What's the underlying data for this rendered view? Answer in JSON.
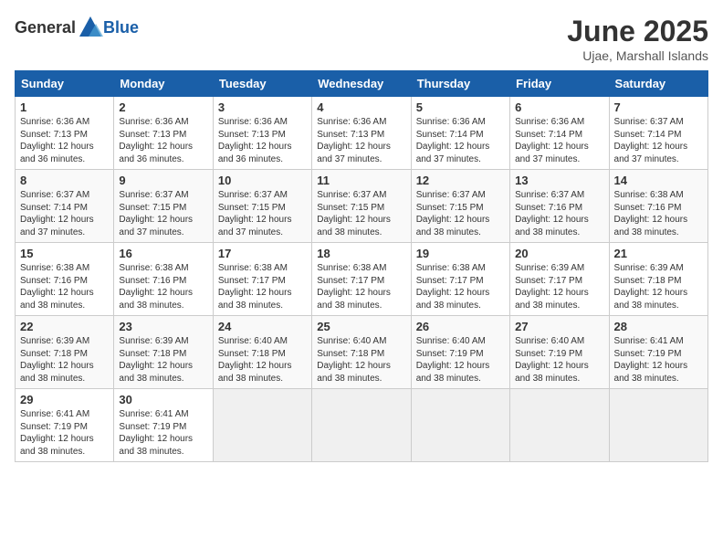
{
  "logo": {
    "general": "General",
    "blue": "Blue"
  },
  "title": "June 2025",
  "subtitle": "Ujae, Marshall Islands",
  "headers": [
    "Sunday",
    "Monday",
    "Tuesday",
    "Wednesday",
    "Thursday",
    "Friday",
    "Saturday"
  ],
  "weeks": [
    [
      {
        "day": "1",
        "sunrise": "6:36 AM",
        "sunset": "7:13 PM",
        "daylight": "12 hours and 36 minutes."
      },
      {
        "day": "2",
        "sunrise": "6:36 AM",
        "sunset": "7:13 PM",
        "daylight": "12 hours and 36 minutes."
      },
      {
        "day": "3",
        "sunrise": "6:36 AM",
        "sunset": "7:13 PM",
        "daylight": "12 hours and 36 minutes."
      },
      {
        "day": "4",
        "sunrise": "6:36 AM",
        "sunset": "7:13 PM",
        "daylight": "12 hours and 37 minutes."
      },
      {
        "day": "5",
        "sunrise": "6:36 AM",
        "sunset": "7:14 PM",
        "daylight": "12 hours and 37 minutes."
      },
      {
        "day": "6",
        "sunrise": "6:36 AM",
        "sunset": "7:14 PM",
        "daylight": "12 hours and 37 minutes."
      },
      {
        "day": "7",
        "sunrise": "6:37 AM",
        "sunset": "7:14 PM",
        "daylight": "12 hours and 37 minutes."
      }
    ],
    [
      {
        "day": "8",
        "sunrise": "6:37 AM",
        "sunset": "7:14 PM",
        "daylight": "12 hours and 37 minutes."
      },
      {
        "day": "9",
        "sunrise": "6:37 AM",
        "sunset": "7:15 PM",
        "daylight": "12 hours and 37 minutes."
      },
      {
        "day": "10",
        "sunrise": "6:37 AM",
        "sunset": "7:15 PM",
        "daylight": "12 hours and 37 minutes."
      },
      {
        "day": "11",
        "sunrise": "6:37 AM",
        "sunset": "7:15 PM",
        "daylight": "12 hours and 38 minutes."
      },
      {
        "day": "12",
        "sunrise": "6:37 AM",
        "sunset": "7:15 PM",
        "daylight": "12 hours and 38 minutes."
      },
      {
        "day": "13",
        "sunrise": "6:37 AM",
        "sunset": "7:16 PM",
        "daylight": "12 hours and 38 minutes."
      },
      {
        "day": "14",
        "sunrise": "6:38 AM",
        "sunset": "7:16 PM",
        "daylight": "12 hours and 38 minutes."
      }
    ],
    [
      {
        "day": "15",
        "sunrise": "6:38 AM",
        "sunset": "7:16 PM",
        "daylight": "12 hours and 38 minutes."
      },
      {
        "day": "16",
        "sunrise": "6:38 AM",
        "sunset": "7:16 PM",
        "daylight": "12 hours and 38 minutes."
      },
      {
        "day": "17",
        "sunrise": "6:38 AM",
        "sunset": "7:17 PM",
        "daylight": "12 hours and 38 minutes."
      },
      {
        "day": "18",
        "sunrise": "6:38 AM",
        "sunset": "7:17 PM",
        "daylight": "12 hours and 38 minutes."
      },
      {
        "day": "19",
        "sunrise": "6:38 AM",
        "sunset": "7:17 PM",
        "daylight": "12 hours and 38 minutes."
      },
      {
        "day": "20",
        "sunrise": "6:39 AM",
        "sunset": "7:17 PM",
        "daylight": "12 hours and 38 minutes."
      },
      {
        "day": "21",
        "sunrise": "6:39 AM",
        "sunset": "7:18 PM",
        "daylight": "12 hours and 38 minutes."
      }
    ],
    [
      {
        "day": "22",
        "sunrise": "6:39 AM",
        "sunset": "7:18 PM",
        "daylight": "12 hours and 38 minutes."
      },
      {
        "day": "23",
        "sunrise": "6:39 AM",
        "sunset": "7:18 PM",
        "daylight": "12 hours and 38 minutes."
      },
      {
        "day": "24",
        "sunrise": "6:40 AM",
        "sunset": "7:18 PM",
        "daylight": "12 hours and 38 minutes."
      },
      {
        "day": "25",
        "sunrise": "6:40 AM",
        "sunset": "7:18 PM",
        "daylight": "12 hours and 38 minutes."
      },
      {
        "day": "26",
        "sunrise": "6:40 AM",
        "sunset": "7:19 PM",
        "daylight": "12 hours and 38 minutes."
      },
      {
        "day": "27",
        "sunrise": "6:40 AM",
        "sunset": "7:19 PM",
        "daylight": "12 hours and 38 minutes."
      },
      {
        "day": "28",
        "sunrise": "6:41 AM",
        "sunset": "7:19 PM",
        "daylight": "12 hours and 38 minutes."
      }
    ],
    [
      {
        "day": "29",
        "sunrise": "6:41 AM",
        "sunset": "7:19 PM",
        "daylight": "12 hours and 38 minutes."
      },
      {
        "day": "30",
        "sunrise": "6:41 AM",
        "sunset": "7:19 PM",
        "daylight": "12 hours and 38 minutes."
      },
      null,
      null,
      null,
      null,
      null
    ]
  ]
}
